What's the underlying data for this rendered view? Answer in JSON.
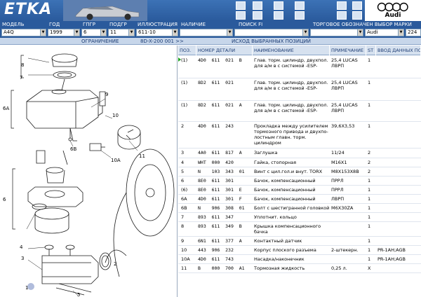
{
  "app": {
    "title": "ETKA",
    "brand": "Audi"
  },
  "labels": {
    "model": "МОДЕЛЬ",
    "year": "ГОД",
    "ggr": "ГПГР",
    "pgr": "ПОДГР",
    "illustration": "ИЛЛЮСТРАЦИЯ",
    "presence": "НАЛИЧИЕ",
    "search": "ПОИСК FI",
    "trademark": "ТОРГОВОЕ ОБОЗНАЧЕН ВЫБОР МАРКИ"
  },
  "fields": {
    "model": "A4Q",
    "year": "1999",
    "ggr": "6",
    "pgr": "11",
    "illustration": "611-10",
    "presence": "",
    "search": "",
    "trademark": "",
    "brand_select": "Audi",
    "extra": "224"
  },
  "info": {
    "restriction": "ОГРАНИЧЕНИЕ",
    "range": "8D-X-200 001 >>",
    "source": "ИСХОД ВЫБРАННЫХ ПОЗИЦИЙ"
  },
  "table": {
    "headers": [
      "ПОЗ.",
      "НОМЕР ДЕТАЛИ",
      "НАИМЕНОВАНИЕ",
      "ПРИМЕЧАНИЕ",
      "ST",
      "ВВОД ДАННЫХ ПО"
    ],
    "rows": [
      {
        "pos": "(1)",
        "part": "4D0  611  021  B",
        "name": "Глав. торм. цилиндр, двухпол. для а/м в с системой -ESP-",
        "note": "25,4  LUCAS\nЛВРП",
        "st": "1",
        "date": ""
      },
      {
        "pos": "(1)",
        "part": "8D2  611  021",
        "name": "Глав. торм. цилиндр, двухпол. для а/м в с системой -ESP-",
        "note": "25,4  LUCAS\nЛВРП",
        "st": "1",
        "date": ""
      },
      {
        "pos": "(1)",
        "part": "8D2  611  021  A",
        "name": "Глав. торм. цилиндр, двухпол. для а/м в с системой -ESP-",
        "note": "25,4  LUCAS\nЛВРП",
        "st": "1",
        "date": ""
      },
      {
        "pos": "2",
        "part": "4D0  611  243",
        "name": "Прокладка между усилителем тормозного привода и двухпо- лостным главн. торм. цилиндром",
        "note": "39,6X3,53",
        "st": "1",
        "date": ""
      },
      {
        "pos": "3",
        "part": "4A0  611  817  A",
        "name": "Заглушка",
        "note": "11/24",
        "st": "2",
        "date": ""
      },
      {
        "pos": "4",
        "part": "WHT  000  420",
        "name": "Гайка, стопорная",
        "note": "M16X1",
        "st": "2",
        "date": ""
      },
      {
        "pos": "5",
        "part": "N    103  343  01",
        "name": "Винт с цил.гол.и внут. TORX",
        "note": "M8X153X8B",
        "st": "2",
        "date": ""
      },
      {
        "pos": "6",
        "part": "8E0  611  301",
        "name": "Бачок, компенсационный",
        "note": "ПРРЛ",
        "st": "1",
        "date": ""
      },
      {
        "pos": "(6)",
        "part": "8E0  611  301  E",
        "name": "Бачок, компенсационный",
        "note": "ПРРЛ",
        "st": "1",
        "date": ""
      },
      {
        "pos": "6A",
        "part": "4D0  611  301  F",
        "name": "Бачок, компенсационный",
        "note": "ЛВРП",
        "st": "1",
        "date": ""
      },
      {
        "pos": "6B",
        "part": "N    906  308  01",
        "name": "Болт с шестигранной головкой",
        "note": "M6X30ZA",
        "st": "1",
        "date": ""
      },
      {
        "pos": "7",
        "part": "893  611  347",
        "name": "Уплотнит. кольцо",
        "note": "",
        "st": "1",
        "date": ""
      },
      {
        "pos": "8",
        "part": "893  611  349  B",
        "name": "Крышка компенсационного бачка",
        "note": "",
        "st": "1",
        "date": ""
      },
      {
        "pos": "9",
        "part": "6N1  611  377  A",
        "name": "Контактный датчик",
        "note": "",
        "st": "1",
        "date": ""
      },
      {
        "pos": "10",
        "part": "443  906  232",
        "name": "Корпус плоского разъема",
        "note": "2-штекерн.",
        "st": "1",
        "date": "PR-1AH;AGB"
      },
      {
        "pos": "10A",
        "part": "4D0  611  743",
        "name": "Насадка/наконечник",
        "note": "",
        "st": "1",
        "date": "PR-1AH;AGB"
      },
      {
        "pos": "11",
        "part": "B    000  700  A1",
        "name": "Тормозная жидкость",
        "note": "0,25 л.",
        "st": "X",
        "date": ""
      }
    ]
  },
  "diagram_labels": [
    "7",
    "8",
    "6A",
    "9",
    "10",
    "10A",
    "6B",
    "6",
    "4",
    "3",
    "11",
    "1",
    "5",
    "2"
  ]
}
